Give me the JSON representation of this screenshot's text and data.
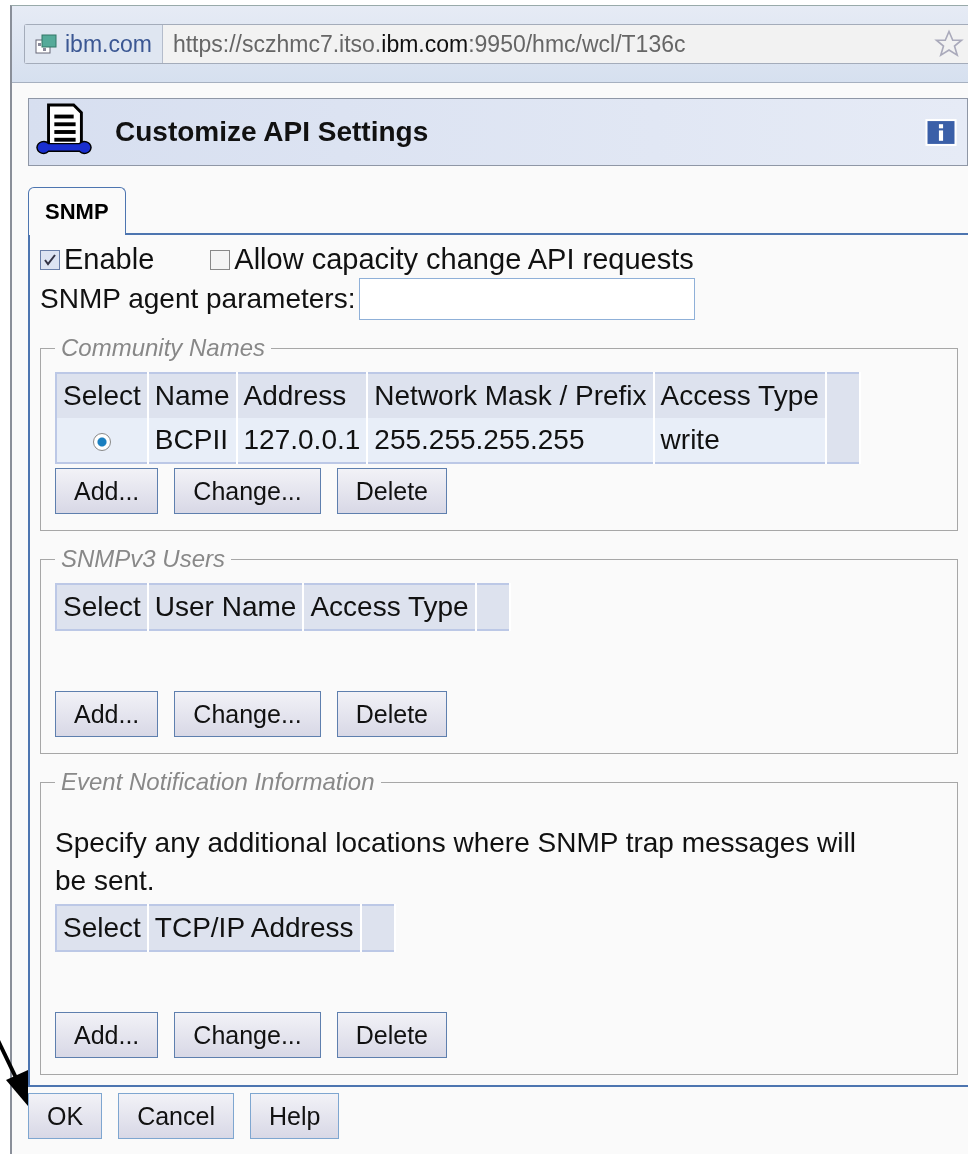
{
  "browser": {
    "site_badge": "ibm.com",
    "url": "https://sczhmc7.itso.**ibm.com**:9950/hmc/wcl/T136c",
    "bookmarked": false
  },
  "dialog": {
    "title": "Customize API Settings"
  },
  "tabs": [
    {
      "label": "SNMP",
      "selected": true
    }
  ],
  "options": [
    {
      "label": "Enable",
      "checked": true
    },
    {
      "label": "Allow capacity change API requests",
      "checked": false
    }
  ],
  "agent_parameters": {
    "label": "SNMP agent parameters:"
  },
  "sections": [
    {
      "title": "Community Names",
      "columns": [
        "Select",
        "Name",
        "Address",
        "Network Mask / Prefix",
        "Access Type"
      ],
      "rows": [
        {
          "selected": true,
          "cells": [
            "",
            "BCPII",
            "127.0.0.1",
            "255.255.255.255",
            "write"
          ]
        }
      ],
      "buttons": [
        "Add...",
        "Change...",
        "Delete"
      ]
    },
    {
      "title": "SNMPv3 Users",
      "columns": [
        "Select",
        "User Name",
        "Access Type"
      ],
      "buttons": [
        "Add...",
        "Change...",
        "Delete"
      ]
    },
    {
      "title": "Event Notification Information",
      "description": "Specify any additional locations where SNMP trap messages will be sent.",
      "columns": [
        "Select",
        "TCP/IP Address"
      ],
      "buttons": [
        "Add...",
        "Change...",
        "Delete"
      ]
    }
  ],
  "footer_buttons": [
    "OK",
    "Cancel",
    "Help"
  ]
}
